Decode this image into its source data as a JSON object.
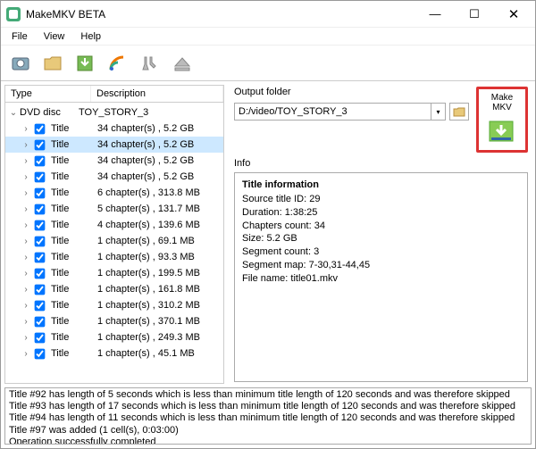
{
  "window": {
    "title": "MakeMKV BETA",
    "min": "—",
    "max": "☐",
    "close": "✕"
  },
  "menu": {
    "file": "File",
    "view": "View",
    "help": "Help"
  },
  "tree": {
    "header_type": "Type",
    "header_desc": "Description",
    "root_label": "DVD disc",
    "root_desc": "TOY_STORY_3",
    "item_label": "Title",
    "items": [
      {
        "desc": "34 chapter(s) , 5.2 GB",
        "selected": false
      },
      {
        "desc": "34 chapter(s) , 5.2 GB",
        "selected": true
      },
      {
        "desc": "34 chapter(s) , 5.2 GB",
        "selected": false
      },
      {
        "desc": "34 chapter(s) , 5.2 GB",
        "selected": false
      },
      {
        "desc": "6 chapter(s) , 313.8 MB",
        "selected": false
      },
      {
        "desc": "5 chapter(s) , 131.7 MB",
        "selected": false
      },
      {
        "desc": "4 chapter(s) , 139.6 MB",
        "selected": false
      },
      {
        "desc": "1 chapter(s) , 69.1 MB",
        "selected": false
      },
      {
        "desc": "1 chapter(s) , 93.3 MB",
        "selected": false
      },
      {
        "desc": "1 chapter(s) , 199.5 MB",
        "selected": false
      },
      {
        "desc": "1 chapter(s) , 161.8 MB",
        "selected": false
      },
      {
        "desc": "1 chapter(s) , 310.2 MB",
        "selected": false
      },
      {
        "desc": "1 chapter(s) , 370.1 MB",
        "selected": false
      },
      {
        "desc": "1 chapter(s) , 249.3 MB",
        "selected": false
      },
      {
        "desc": "1 chapter(s) , 45.1 MB",
        "selected": false
      }
    ]
  },
  "output": {
    "label": "Output folder",
    "value": "D:/video/TOY_STORY_3"
  },
  "makemkv": {
    "label": "Make MKV"
  },
  "info": {
    "label": "Info",
    "heading": "Title information",
    "rows": [
      "Source title ID: 29",
      "Duration: 1:38:25",
      "Chapters count: 34",
      "Size: 5.2 GB",
      "Segment count: 3",
      "Segment map: 7-30,31-44,45",
      "File name: title01.mkv"
    ]
  },
  "log": [
    "Title #92 has length of 5 seconds which is less than minimum title length of 120 seconds and was therefore skipped",
    "Title #93 has length of 17 seconds which is less than minimum title length of 120 seconds and was therefore skipped",
    "Title #94 has length of 11 seconds which is less than minimum title length of 120 seconds and was therefore skipped",
    "Title #97 was added (1 cell(s), 0:03:00)",
    "Operation successfully completed"
  ]
}
